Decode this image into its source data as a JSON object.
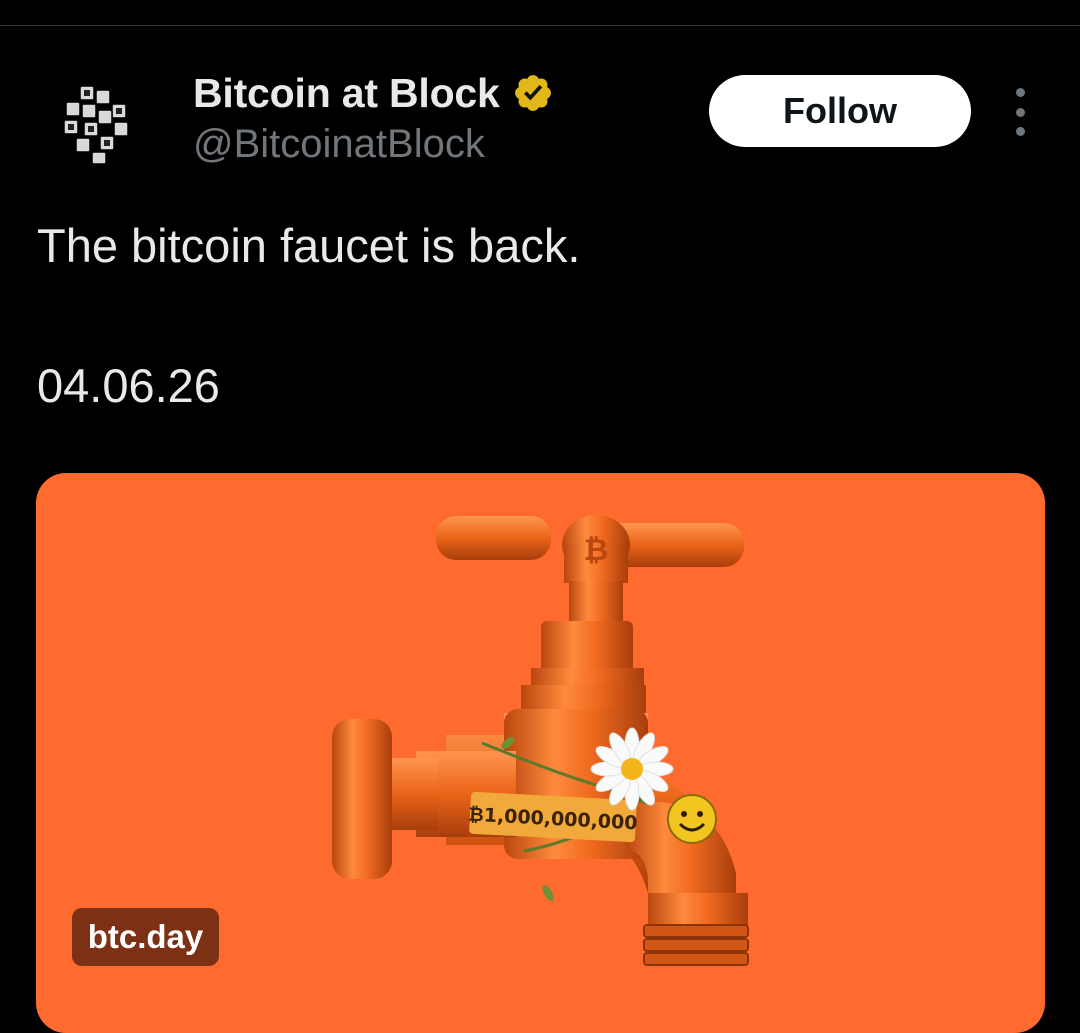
{
  "profile": {
    "display_name": "Bitcoin at Block",
    "handle": "@BitcoinatBlock",
    "verified": true,
    "verified_badge_color": "#e2b719"
  },
  "header": {
    "follow_label": "Follow",
    "more_icon": "more-vertical-icon"
  },
  "tweet": {
    "text": "The bitcoin faucet is back.",
    "date": "04.06.26"
  },
  "media": {
    "background_color": "#ff6b2e",
    "tag_text": "₿1,000,000,000",
    "link_label": "btc.day"
  },
  "colors": {
    "background": "#000000",
    "primary_text": "#e7e9ea",
    "secondary_text": "#71767b"
  }
}
